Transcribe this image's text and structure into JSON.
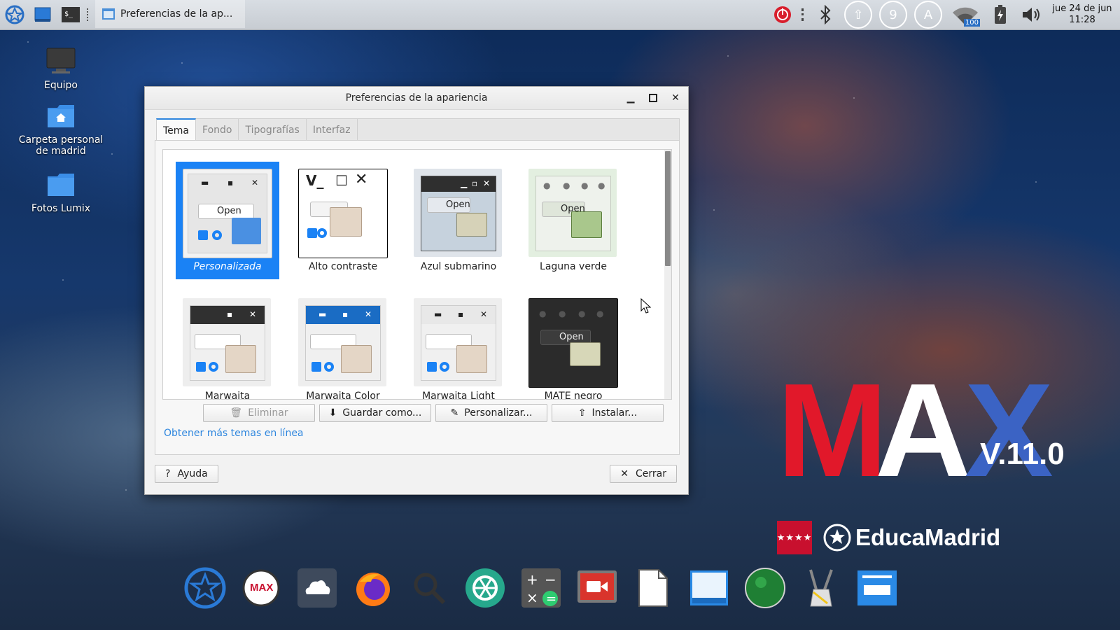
{
  "top_panel": {
    "task_label": "Preferencias de la ap...",
    "clock_date": "jue 24 de jun",
    "clock_time": "11:28",
    "indicators": [
      "power-indicator",
      "bluetooth-icon",
      "update-indicator",
      "9",
      "A",
      "wifi-icon",
      "battery-icon",
      "volume-icon"
    ],
    "wifi_badge": "100"
  },
  "desktop": {
    "icons": [
      {
        "label": "Equipo"
      },
      {
        "label": "Carpeta personal de madrid"
      },
      {
        "label": "Fotos Lumix"
      }
    ]
  },
  "branding": {
    "letters": [
      "M",
      "A",
      "X"
    ],
    "colors": [
      "#e1182a",
      "#ffffff",
      "#3b63c4"
    ],
    "version": "V.11.0",
    "educa": "EducaMadrid",
    "flag_stars": "★★★★"
  },
  "window": {
    "title": "Preferencias de la apariencia",
    "controls": [
      "minimize",
      "maximize",
      "close"
    ],
    "tabs": [
      "Tema",
      "Fondo",
      "Tipografías",
      "Interfaz"
    ],
    "active_tab": "Tema",
    "themes": [
      {
        "label": "Personalizada",
        "selected": true
      },
      {
        "label": "Alto contraste"
      },
      {
        "label": "Azul submarino"
      },
      {
        "label": "Laguna verde"
      },
      {
        "label": "Marwaita"
      },
      {
        "label": "Marwaita Color"
      },
      {
        "label": "Marwaita Light"
      },
      {
        "label": "MATE negro"
      }
    ],
    "thumb_open_label": "Open",
    "action_buttons": {
      "delete": "Eliminar",
      "save_as": "Guardar como...",
      "customize": "Personalizar...",
      "install": "Instalar..."
    },
    "online_link": "Obtener más temas en línea",
    "help": "Ayuda",
    "close": "Cerrar"
  },
  "colors": {
    "accent": "#1a82f5",
    "link": "#2e86de"
  }
}
